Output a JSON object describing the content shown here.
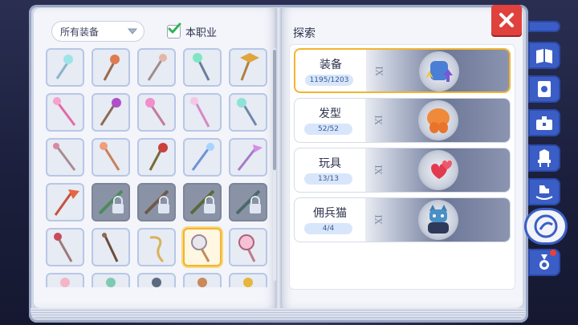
{
  "filter": {
    "selected": "所有装备"
  },
  "class_filter": {
    "label": "本职业",
    "checked": true
  },
  "explore": {
    "title": "探索",
    "cards": [
      {
        "label": "装备",
        "count": "1195/1203",
        "icon": "armor-icon",
        "active": true
      },
      {
        "label": "发型",
        "count": "52/52",
        "icon": "hair-icon",
        "active": false
      },
      {
        "label": "玩具",
        "count": "13/13",
        "icon": "hearts-icon",
        "active": false
      },
      {
        "label": "佣兵猫",
        "count": "4/4",
        "icon": "cat-icon",
        "active": false
      }
    ]
  },
  "card_roman": "IX",
  "tabs": [
    "tab-1-icon",
    "book-icon",
    "card-icon",
    "chest-icon",
    "throne-icon",
    "rocking-horse-icon",
    "compass-icon",
    "medal-icon"
  ],
  "colors": {
    "accent": "#3b5ec6",
    "highlight": "#f2b430",
    "close": "#e0413d"
  }
}
